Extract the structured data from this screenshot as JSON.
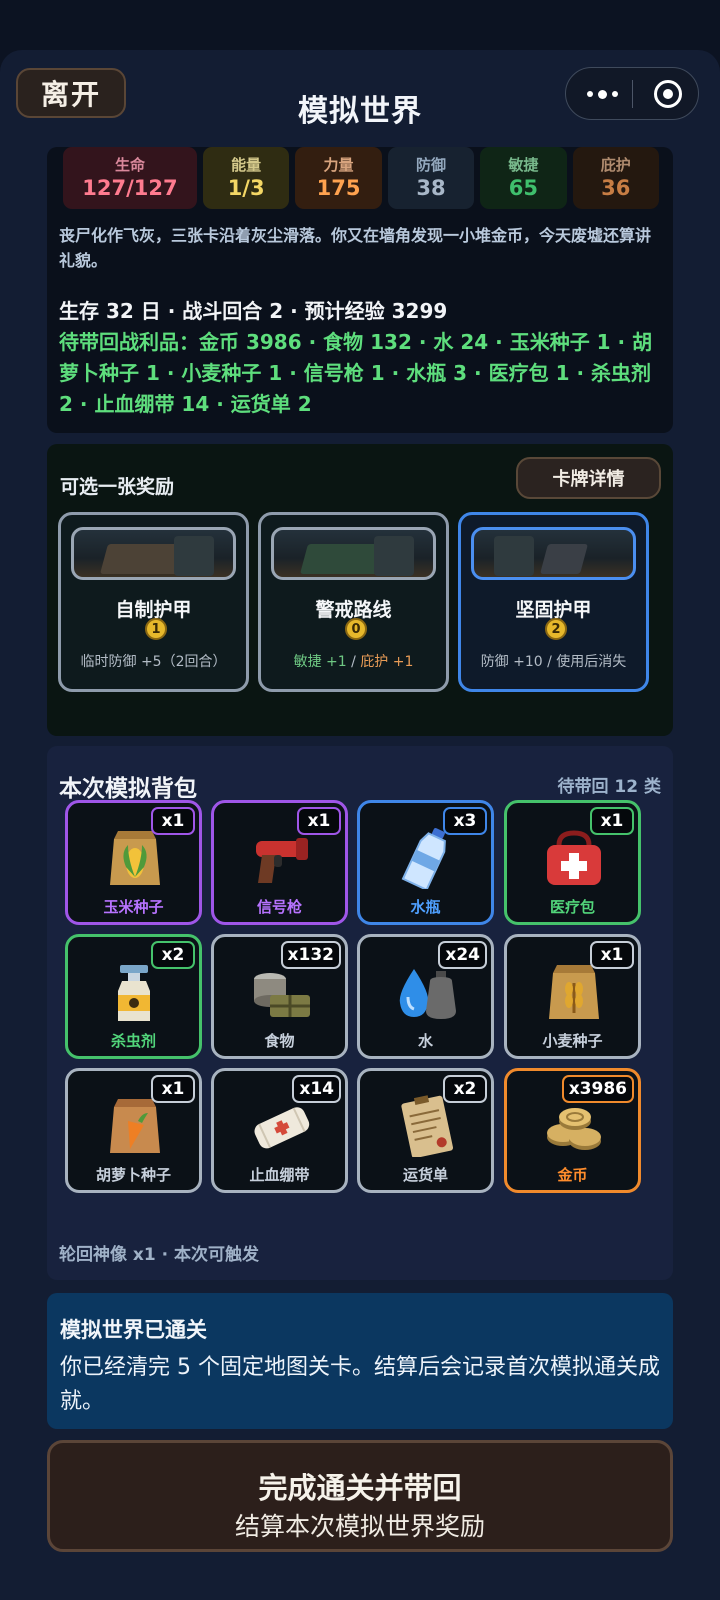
{
  "header": {
    "leave_label": "离开",
    "title": "模拟世界"
  },
  "stats": [
    {
      "label": "生命",
      "value": "127/127"
    },
    {
      "label": "能量",
      "value": "1/3"
    },
    {
      "label": "力量",
      "value": "175"
    },
    {
      "label": "防御",
      "value": "38"
    },
    {
      "label": "敏捷",
      "value": "65"
    },
    {
      "label": "庇护",
      "value": "36"
    }
  ],
  "story": "丧尸化作飞灰，三张卡沿着灰尘滑落。你又在墙角发现一小堆金币，今天废墟还算讲礼貌。",
  "summary": "生存 32 日 · 战斗回合 2 · 预计经验 3299",
  "loot": "待带回战利品：金币 3986 · 食物 132 · 水 24 · 玉米种子 1 · 胡萝卜种子 1 · 小麦种子 1 · 信号枪 1 · 水瓶 3 · 医疗包 1 · 杀虫剂 2 · 止血绷带 14 · 运货单 2",
  "reward": {
    "title": "可选一张奖励",
    "detail_label": "卡牌详情",
    "cards": [
      {
        "name": "自制护甲",
        "cost": "1",
        "desc": "临时防御 +5（2回合）"
      },
      {
        "name": "警戒路线",
        "cost": "0",
        "desc_a": "敏捷 +1",
        "desc_sep": " / ",
        "desc_b": "庇护 +1"
      },
      {
        "name": "坚固护甲",
        "cost": "2",
        "desc": "防御 +10 / 使用后消失"
      }
    ]
  },
  "bag": {
    "title": "本次模拟背包",
    "count": "待带回 12 类",
    "items": [
      {
        "name": "玉米种子",
        "qty": "x1",
        "icon": "corn-seed-bag-icon"
      },
      {
        "name": "信号枪",
        "qty": "x1",
        "icon": "flare-gun-icon"
      },
      {
        "name": "水瓶",
        "qty": "x3",
        "icon": "water-bottle-icon"
      },
      {
        "name": "医疗包",
        "qty": "x1",
        "icon": "medkit-icon"
      },
      {
        "name": "杀虫剂",
        "qty": "x2",
        "icon": "spray-bottle-icon"
      },
      {
        "name": "食物",
        "qty": "x132",
        "icon": "canned-food-icon"
      },
      {
        "name": "水",
        "qty": "x24",
        "icon": "water-drop-icon"
      },
      {
        "name": "小麦种子",
        "qty": "x1",
        "icon": "wheat-seed-bag-icon"
      },
      {
        "name": "胡萝卜种子",
        "qty": "x1",
        "icon": "carrot-seed-bag-icon"
      },
      {
        "name": "止血绷带",
        "qty": "x14",
        "icon": "bandage-icon"
      },
      {
        "name": "运货单",
        "qty": "x2",
        "icon": "manifest-paper-icon"
      },
      {
        "name": "金币",
        "qty": "x3986",
        "icon": "gold-coins-icon"
      }
    ],
    "footer": "轮回神像 x1 · 本次可触发"
  },
  "clear": {
    "title": "模拟世界已通关",
    "text": "你已经清完 5 个固定地图关卡。结算后会记录首次模拟通关成就。"
  },
  "finish": {
    "main": "完成通关并带回",
    "sub": "结算本次模拟世界奖励"
  },
  "colors": {
    "purple": "#9f56e8",
    "blue": "#3f86e8",
    "green": "#45c26b",
    "orange": "#f08a2c",
    "white": "#a8b3c0"
  }
}
